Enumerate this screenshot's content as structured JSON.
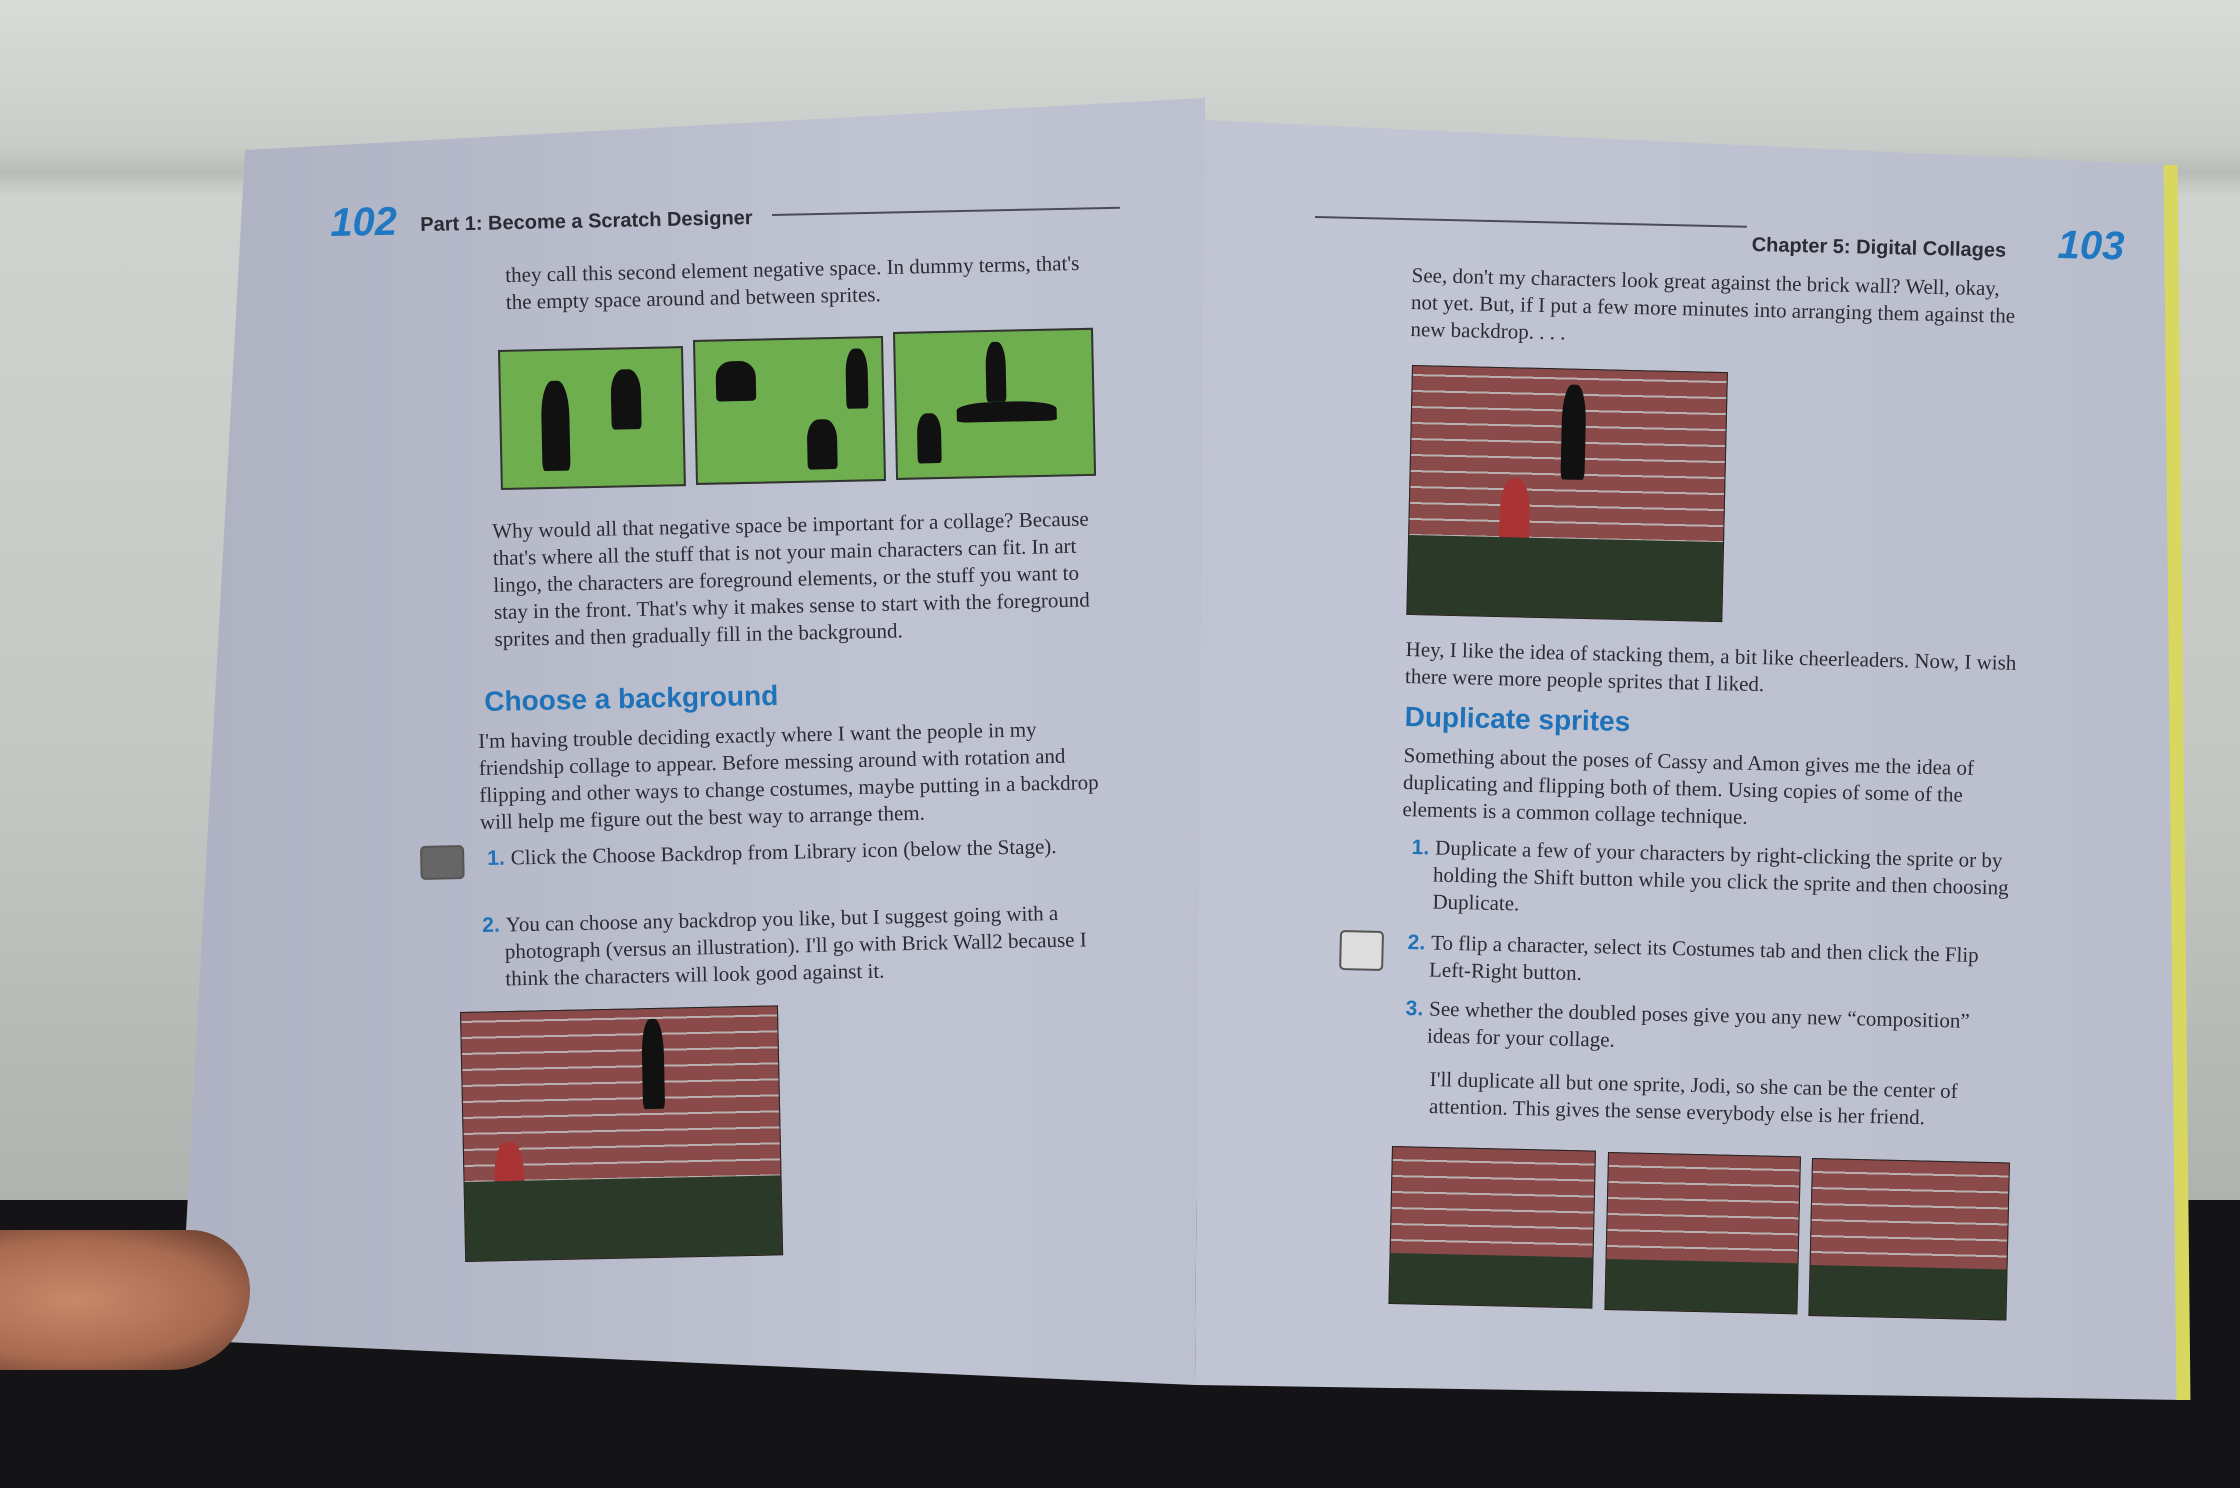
{
  "left_page": {
    "page_number": "102",
    "running_head": "Part 1: Become a Scratch Designer",
    "intro": "they call this second element negative space. In dummy terms, that's the empty space around and between sprites.",
    "paragraph1": "Why would all that negative space be important for a collage? Because that's where all the stuff that is not your main characters can fit. In art lingo, the characters are foreground elements, or the stuff you want to stay in the front. That's why it makes sense to start with the foreground sprites and then gradually fill in the background.",
    "heading": "Choose a background",
    "paragraph2": "I'm having trouble deciding exactly where I want the people in my friendship collage to appear. Before messing around with rotation and flipping and other ways to change costumes, maybe putting in a backdrop will help me figure out the best way to arrange them.",
    "steps": [
      {
        "num": "1.",
        "text": "Click the Choose Backdrop from Library icon (below the Stage)."
      },
      {
        "num": "2.",
        "text": "You can choose any backdrop you like, but I suggest going with a photograph (versus an illustration). I'll go with Brick Wall2 because I think the characters will look good against it."
      }
    ]
  },
  "right_page": {
    "page_number": "103",
    "running_head": "Chapter 5: Digital Collages",
    "intro": "See, don't my characters look great against the brick wall? Well, okay, not yet. But, if I put a few more minutes into arranging them against the new backdrop. . . .",
    "paragraph1": "Hey, I like the idea of stacking them, a bit like cheerleaders. Now, I wish there were more people sprites that I liked.",
    "heading": "Duplicate sprites",
    "paragraph2": "Something about the poses of Cassy and Amon gives me the idea of duplicating and flipping both of them. Using copies of some of the elements is a common collage technique.",
    "steps": [
      {
        "num": "1.",
        "text": "Duplicate a few of your characters by right-clicking the sprite or by holding the Shift button while you click the sprite and then choosing Duplicate."
      },
      {
        "num": "2.",
        "text": "To flip a character, select its Costumes tab and then click the Flip Left-Right button."
      },
      {
        "num": "3.",
        "text": "See whether the doubled poses give you any new “composition” ideas for your collage."
      }
    ],
    "paragraph3": "I'll duplicate all but one sprite, Jodi, so she can be the center of attention. This gives the sense everybody else is her friend."
  }
}
